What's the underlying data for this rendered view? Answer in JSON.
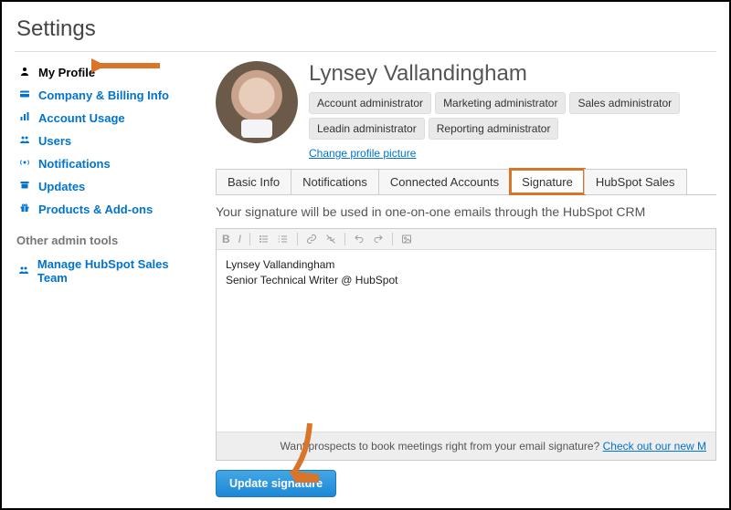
{
  "page_title": "Settings",
  "sidebar": {
    "items": [
      {
        "label": "My Profile",
        "icon": "user-icon",
        "active": true
      },
      {
        "label": "Company & Billing Info",
        "icon": "card-icon",
        "active": false
      },
      {
        "label": "Account Usage",
        "icon": "bar-chart-icon",
        "active": false
      },
      {
        "label": "Users",
        "icon": "users-icon",
        "active": false
      },
      {
        "label": "Notifications",
        "icon": "broadcast-icon",
        "active": false
      },
      {
        "label": "Updates",
        "icon": "archive-icon",
        "active": false
      },
      {
        "label": "Products & Add-ons",
        "icon": "gift-icon",
        "active": false
      }
    ],
    "other_tools_header": "Other admin tools",
    "other_tools": [
      {
        "label": "Manage HubSpot Sales Team",
        "icon": "users-icon"
      }
    ]
  },
  "profile": {
    "name": "Lynsey Vallandingham",
    "roles": [
      "Account administrator",
      "Marketing administrator",
      "Sales administrator",
      "Leadin administrator",
      "Reporting administrator"
    ],
    "change_picture_label": "Change profile picture"
  },
  "tabs": [
    {
      "label": "Basic Info",
      "active": false
    },
    {
      "label": "Notifications",
      "active": false
    },
    {
      "label": "Connected Accounts",
      "active": false
    },
    {
      "label": "Signature",
      "active": true,
      "highlight": true
    },
    {
      "label": "HubSpot Sales",
      "active": false
    }
  ],
  "signature": {
    "note": "Your signature will be used in one-on-one emails through the HubSpot CRM",
    "body_line1": "Lynsey Vallandingham",
    "body_line2": "Senior Technical Writer @ HubSpot",
    "prospect_bar_text": "Want prospects to book meetings right from your email signature? ",
    "prospect_bar_link": "Check out our new M",
    "update_button_label": "Update signature"
  },
  "annotations": {
    "arrow_color": "#d97528"
  }
}
